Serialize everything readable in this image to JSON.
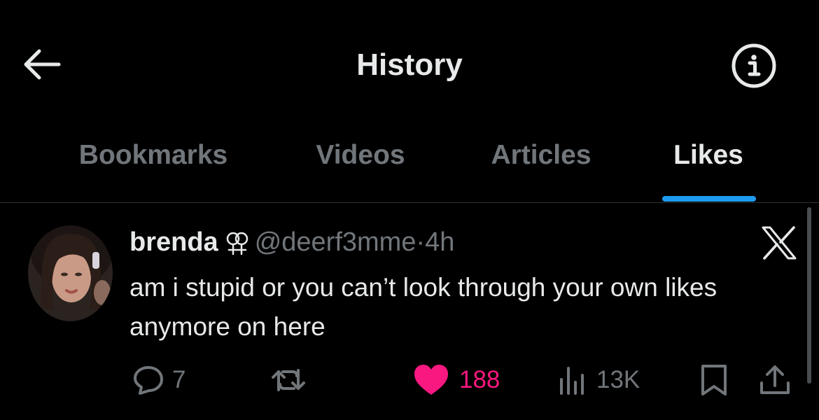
{
  "header": {
    "title": "History",
    "back_icon": "arrow-left-icon",
    "info_icon": "info-icon"
  },
  "tabs": [
    {
      "label": "Bookmarks",
      "active": false
    },
    {
      "label": "Videos",
      "active": false
    },
    {
      "label": "Articles",
      "active": false
    },
    {
      "label": "Likes",
      "active": true
    }
  ],
  "colors": {
    "accent": "#1d9bf0",
    "like": "#f91880",
    "muted": "#71767b",
    "text": "#e7e9ea",
    "background": "#000000"
  },
  "tweet": {
    "author_name": "brenda",
    "name_badge_icon": "double-venus-icon",
    "handle": "@deerf3mme",
    "separator": "·",
    "time": "4h",
    "source_icon": "x-logo-icon",
    "text": "am i stupid or you can’t look through your own likes anymore on here",
    "actions": {
      "replies": "7",
      "retweets": "",
      "likes": "188",
      "liked": true,
      "views": "13K"
    }
  }
}
